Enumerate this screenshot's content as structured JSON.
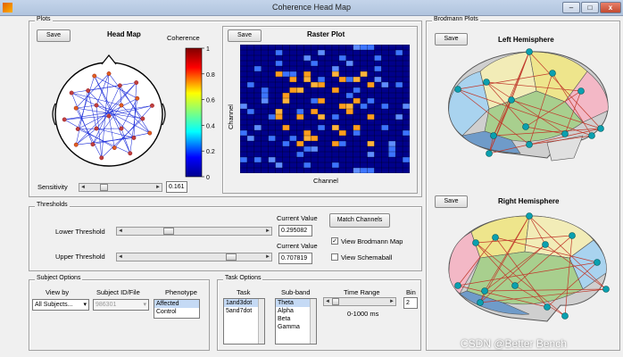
{
  "window": {
    "title": "Coherence Head Map",
    "minimize": "–",
    "maximize": "□",
    "close": "x"
  },
  "plots_panel": {
    "legend": "Plots",
    "headmap": {
      "save": "Save",
      "title": "Head Map",
      "colorbar_title": "Coherence",
      "colorbar_ticks": [
        "1",
        "0.8",
        "0.6",
        "0.4",
        "0.2",
        "0"
      ],
      "sensitivity_label": "Sensitivity",
      "sensitivity_value": "0.161"
    },
    "raster": {
      "save": "Save",
      "title": "Raster Plot",
      "ylabel": "Channel",
      "xlabel": "Channel"
    }
  },
  "thresholds_panel": {
    "legend": "Thresholds",
    "lower_label": "Lower Threshold",
    "upper_label": "Upper Threshold",
    "current_value_label": "Current Value",
    "lower_value": "0.295082",
    "upper_value": "0.707819",
    "lower_level": 0.35,
    "upper_level": 0.72,
    "match_channels": "Match Channels",
    "view_brodmann": "View Brodmann Map",
    "view_brodmann_checked": true,
    "view_schemaball": "View Schemaball",
    "view_schemaball_checked": false
  },
  "subject_panel": {
    "legend": "Subject Options",
    "view_by_label": "View by",
    "view_by_value": "All Subjects...",
    "subject_label": "Subject ID/File",
    "subject_value": "986301",
    "phenotype_label": "Phenotype",
    "phenotype_options": [
      "Affected",
      "Control"
    ]
  },
  "task_panel": {
    "legend": "Task Options",
    "task_label": "Task",
    "tasks": [
      "1and3dot",
      "5and7dot"
    ],
    "subband_label": "Sub-band",
    "subbands": [
      "Theta",
      "Alpha",
      "Beta",
      "Gamma"
    ],
    "time_range_label": "Time Range",
    "time_range_value": "0-1000 ms",
    "bin_label": "Bin",
    "bin_value": "2"
  },
  "brodmann_panel": {
    "legend": "Brodmann Plots",
    "left": {
      "save": "Save",
      "title": "Left Hemisphere"
    },
    "right": {
      "save": "Save",
      "title": "Right Hemisphere"
    }
  },
  "watermark": "CSDN @Better Bench"
}
